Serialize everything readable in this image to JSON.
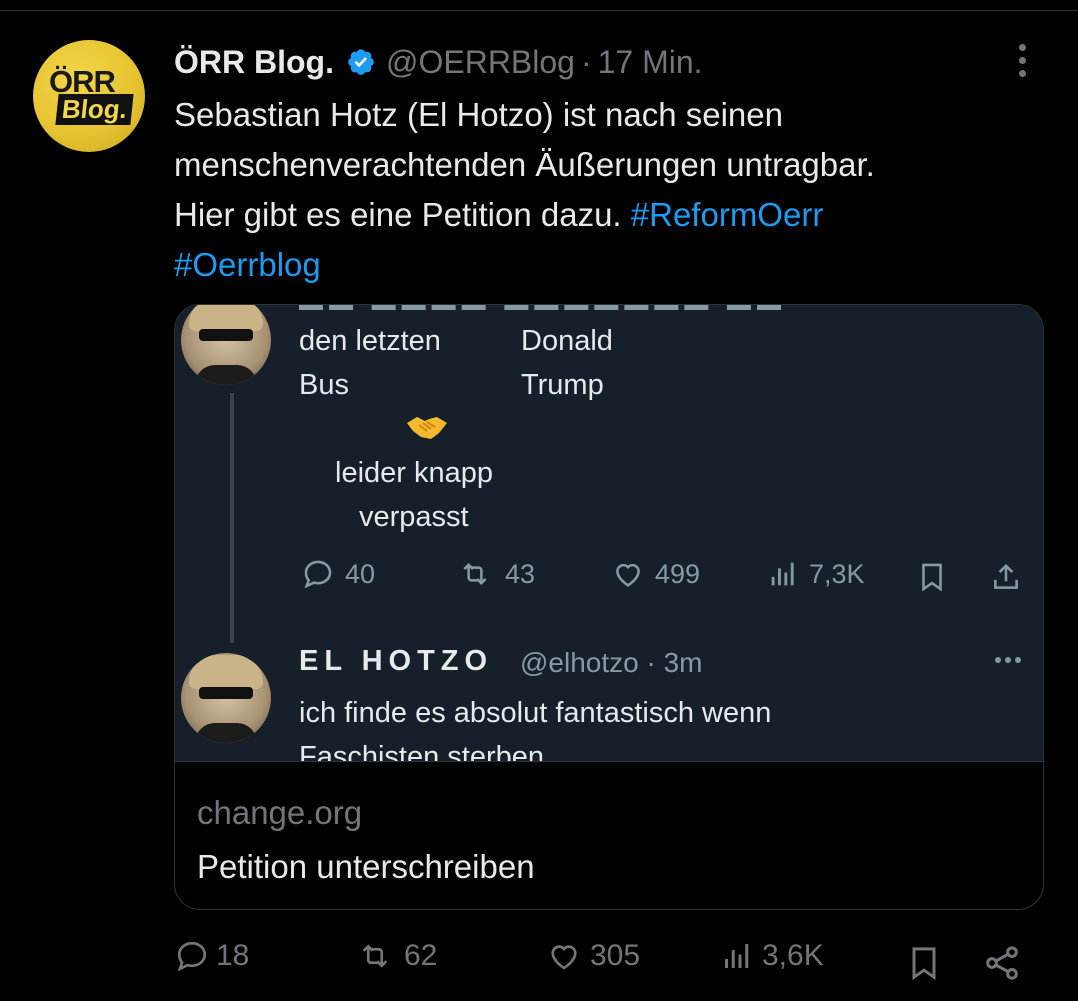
{
  "tweet": {
    "author_name": "ÖRR Blog.",
    "handle": "@OERRBlog",
    "separator": "·",
    "time": "17 Min.",
    "avatar_line1": "ÖRR",
    "avatar_line2": "Blog.",
    "text_plain": "Sebastian Hotz (El Hotzo) ist nach seinen\nmenschenverachtenden Äußerungen untragbar.\nHier gibt es eine Petition dazu. ",
    "hashtag1": "#ReformOerr",
    "hashtag2": "#Oerrblog",
    "link_color": "#1d9bf0"
  },
  "card": {
    "domain": "change.org",
    "title": "Petition unterschreiben",
    "embedded": {
      "col1_line1": "den letzten",
      "col1_line2": "Bus",
      "col2_line1": "Donald",
      "col2_line2": "Trump",
      "caption_line1": "leider knapp",
      "caption_line2": "verpasst",
      "replies": "40",
      "retweets": "43",
      "likes": "499",
      "views": "7,3K",
      "reply_author": "EL HOTZO",
      "reply_handle": "@elhotzo",
      "reply_sep": "·",
      "reply_time": "3m",
      "reply_text_line1": "ich finde es absolut fantastisch wenn",
      "reply_text_line2": "Faschisten sterben"
    }
  },
  "actions": {
    "replies": "18",
    "reposts": "62",
    "likes": "305",
    "views": "3,6K"
  },
  "icons": [
    "verified-badge-icon",
    "more-icon",
    "reply-icon",
    "repost-icon",
    "like-icon",
    "views-icon",
    "bookmark-icon",
    "share-icon"
  ]
}
